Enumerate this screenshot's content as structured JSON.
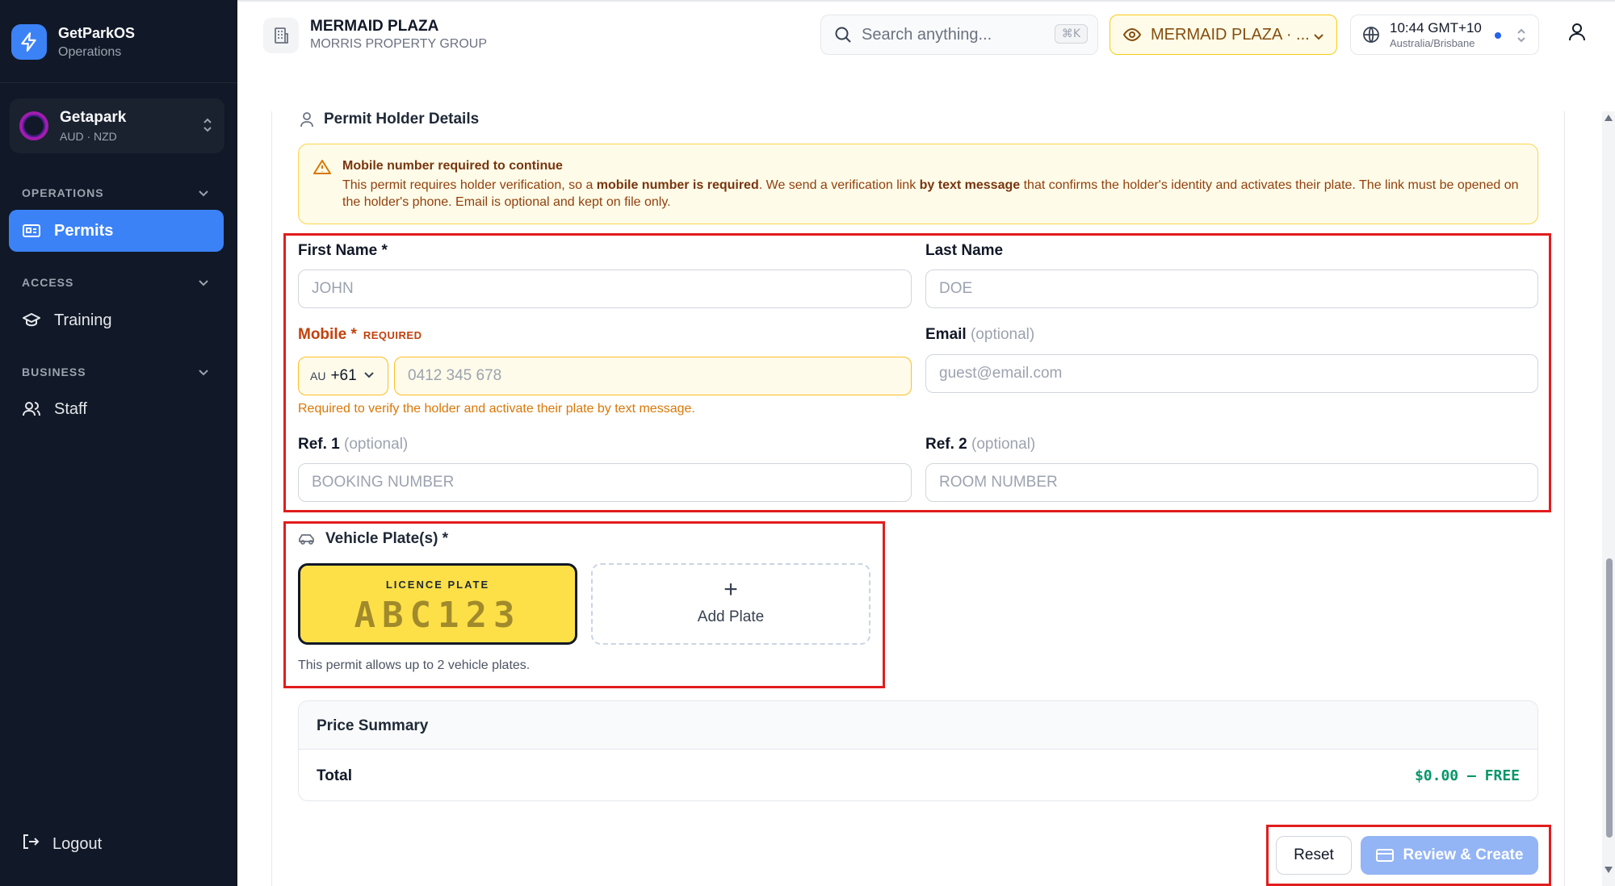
{
  "brand": {
    "name": "GetParkOS",
    "subtitle": "Operations"
  },
  "org": {
    "name": "Getapark",
    "currencies": "AUD · NZD"
  },
  "sidebar": {
    "sections": [
      {
        "label": "OPERATIONS",
        "items": [
          {
            "label": "Permits",
            "icon": "id-card-icon",
            "active": true
          }
        ]
      },
      {
        "label": "ACCESS",
        "items": [
          {
            "label": "Training",
            "icon": "graduation-cap-icon",
            "active": false
          }
        ]
      },
      {
        "label": "BUSINESS",
        "items": [
          {
            "label": "Staff",
            "icon": "users-icon",
            "active": false
          }
        ]
      }
    ],
    "logout": "Logout"
  },
  "header": {
    "site_title": "MERMAID PLAZA",
    "site_subtitle": "MORRIS PROPERTY GROUP",
    "search_placeholder": "Search anything...",
    "search_shortcut": "⌘K",
    "site_selector": "MERMAID PLAZA · ...",
    "time": "10:44 GMT+10",
    "timezone": "Australia/Brisbane"
  },
  "holder": {
    "heading": "Permit Holder Details",
    "alert": {
      "title": "Mobile number required to continue",
      "body_1": "This permit requires holder verification, so a ",
      "body_bold_1": "mobile number is required",
      "body_2": ". We send a verification link ",
      "body_bold_2": "by text message",
      "body_3": " that confirms the holder's identity and activates their plate. The link must be opened on the holder's phone. Email is optional and kept on file only."
    },
    "first_name": {
      "label": "First Name *",
      "placeholder": "JOHN"
    },
    "last_name": {
      "label": "Last Name",
      "placeholder": "DOE"
    },
    "mobile": {
      "label": "Mobile *",
      "required_tag": "REQUIRED",
      "country_code": "AU",
      "dial_code": "+61",
      "placeholder": "0412 345 678",
      "hint": "Required to verify the holder and activate their plate by text message."
    },
    "email": {
      "label": "Email",
      "optional": "(optional)",
      "placeholder": "guest@email.com"
    },
    "ref1": {
      "label": "Ref. 1",
      "optional": "(optional)",
      "placeholder": "BOOKING NUMBER"
    },
    "ref2": {
      "label": "Ref. 2",
      "optional": "(optional)",
      "placeholder": "ROOM NUMBER"
    }
  },
  "vehicles": {
    "heading": "Vehicle Plate(s) *",
    "plate_tag": "LICENCE PLATE",
    "plate_number": "ABC123",
    "add_plate": "Add Plate",
    "note": "This permit allows up to 2 vehicle plates."
  },
  "price": {
    "title": "Price Summary",
    "total_label": "Total",
    "total_value": "$0.00 — FREE"
  },
  "actions": {
    "reset": "Reset",
    "create": "Review & Create"
  },
  "colors": {
    "accent": "#3b82f6",
    "sidebar_bg": "#111827",
    "warning": "#c2410c",
    "success": "#059669",
    "highlight": "#e11d1d"
  }
}
